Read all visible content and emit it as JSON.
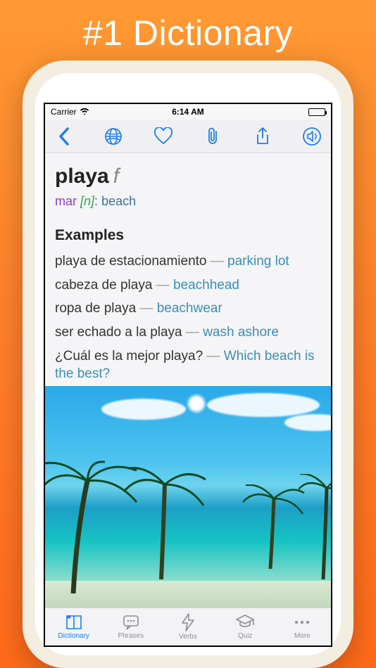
{
  "promo": {
    "title": "#1 Dictionary"
  },
  "status": {
    "carrier": "Carrier",
    "time": "6:14 AM"
  },
  "toolbar": {
    "back": "Back",
    "globe": "Language",
    "heart": "Favorite",
    "clip": "Attachment",
    "share": "Share",
    "speaker": "Pronounce"
  },
  "entry": {
    "headword": "playa",
    "gender": "f",
    "sense_domain": "mar",
    "sense_gram": "[n]",
    "sense_colon": ":",
    "sense_translation": "beach"
  },
  "examples_heading": "Examples",
  "examples": [
    {
      "src": "playa de estacionamiento",
      "dash": "—",
      "trans": "parking lot"
    },
    {
      "src": "cabeza de playa",
      "dash": "—",
      "trans": "beachhead"
    },
    {
      "src": "ropa de playa",
      "dash": "—",
      "trans": "beachwear"
    },
    {
      "src": "ser echado a la playa",
      "dash": "—",
      "trans": "wash ashore"
    },
    {
      "src": "¿Cuál es la mejor playa?",
      "dash": "—",
      "trans": "Which beach is the best?"
    }
  ],
  "tabs": {
    "dictionary": "Dictionary",
    "phrases": "Phrases",
    "verbs": "Verbs",
    "quiz": "Quiz",
    "more": "More"
  },
  "image_alt": "Tropical beach with palm trees",
  "colors": {
    "accent": "#1e7df0",
    "link": "#3b8db8"
  }
}
